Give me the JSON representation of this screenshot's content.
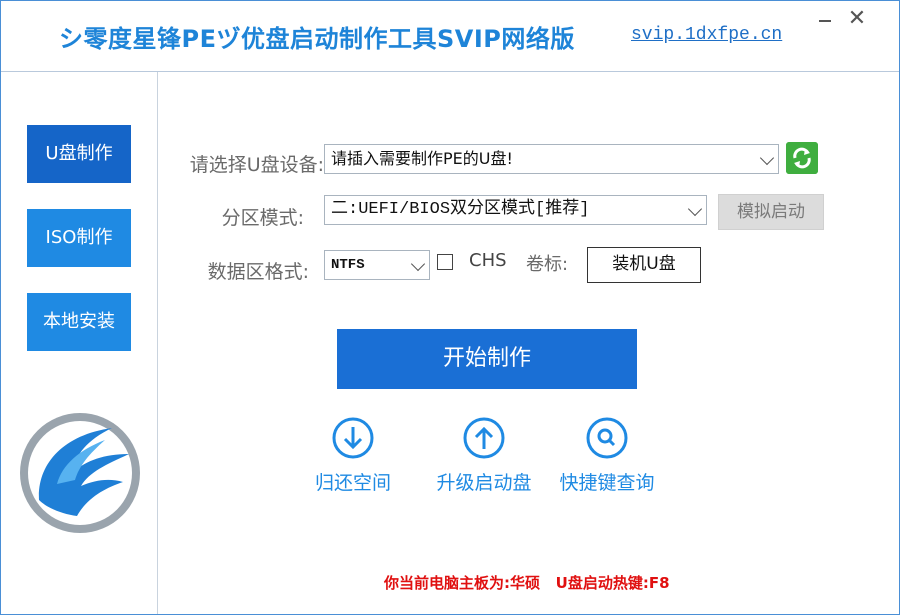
{
  "window": {
    "title": "シ零度星锋PEヅ优盘启动制作工具SVIP网络版",
    "site_link": "svip.1dxfpe.cn",
    "minimize_icon": "minimize-icon",
    "close_symbol": "✕"
  },
  "sidebar": {
    "items": [
      {
        "label": "U盘制作",
        "active": true
      },
      {
        "label": "ISO制作",
        "active": false
      },
      {
        "label": "本地安装",
        "active": false
      }
    ],
    "logo_icon": "app-logo-icon"
  },
  "form": {
    "device_label": "请选择U盘设备:",
    "device_value": "请插入需要制作PE的U盘!",
    "partition_label": "分区模式:",
    "partition_value": "二:UEFI/BIOS双分区模式[推荐]",
    "simulate_button": "模拟启动",
    "format_label": "数据区格式:",
    "format_value": "NTFS",
    "chs_label": "CHS",
    "chs_checked": false,
    "volume_label": "卷标:",
    "volume_value": "装机U盘"
  },
  "start_button": "开始制作",
  "actions": [
    {
      "label": "归还空间",
      "icon": "arrow-down-circle-icon"
    },
    {
      "label": "升级启动盘",
      "icon": "arrow-up-circle-icon"
    },
    {
      "label": "快捷键查询",
      "icon": "search-circle-icon"
    }
  ],
  "status": {
    "text": "你当前电脑主板为:华硕   U盘启动热键:F8"
  },
  "colors": {
    "accent": "#1f8ae3",
    "active": "#1565c8",
    "status_red": "#e01010"
  }
}
